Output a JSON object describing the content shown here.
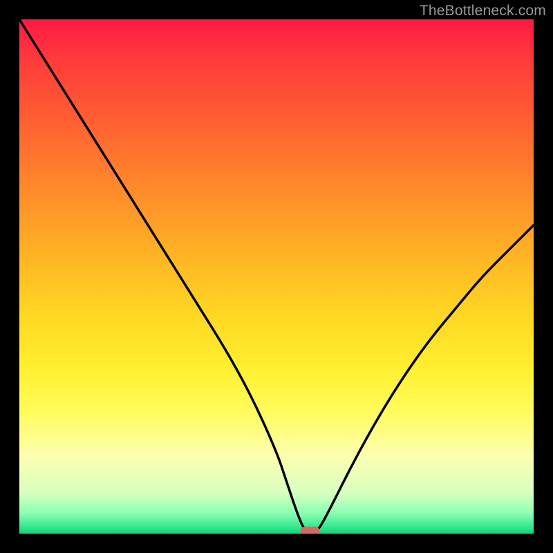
{
  "watermark": "TheBottleneck.com",
  "colors": {
    "frame": "#000000",
    "marker": "#d66a62",
    "curve": "#000000"
  },
  "chart_data": {
    "type": "line",
    "title": "",
    "xlabel": "",
    "ylabel": "",
    "xlim": [
      0,
      100
    ],
    "ylim": [
      0,
      100
    ],
    "grid": false,
    "legend": false,
    "series": [
      {
        "name": "bottleneck-curve",
        "x": [
          0,
          5,
          10,
          15,
          20,
          25,
          30,
          35,
          40,
          45,
          50,
          52,
          54,
          55.5,
          57,
          58,
          60,
          65,
          70,
          75,
          80,
          85,
          90,
          95,
          100
        ],
        "y": [
          100,
          92,
          84,
          76,
          68,
          60,
          52,
          44,
          36,
          27,
          16,
          10,
          4,
          0.5,
          0.5,
          0.5,
          4,
          14,
          23,
          31,
          38,
          44,
          50,
          55,
          60
        ]
      }
    ],
    "annotations": [
      {
        "name": "optimal-marker",
        "x": 56.5,
        "y": 0.5,
        "shape": "pill"
      }
    ],
    "background_gradient": {
      "orientation": "vertical",
      "stops": [
        {
          "pos": 0.0,
          "hex": "#ff1a44"
        },
        {
          "pos": 0.5,
          "hex": "#ffd823"
        },
        {
          "pos": 0.85,
          "hex": "#fcffb0"
        },
        {
          "pos": 1.0,
          "hex": "#16cf77"
        }
      ]
    }
  }
}
